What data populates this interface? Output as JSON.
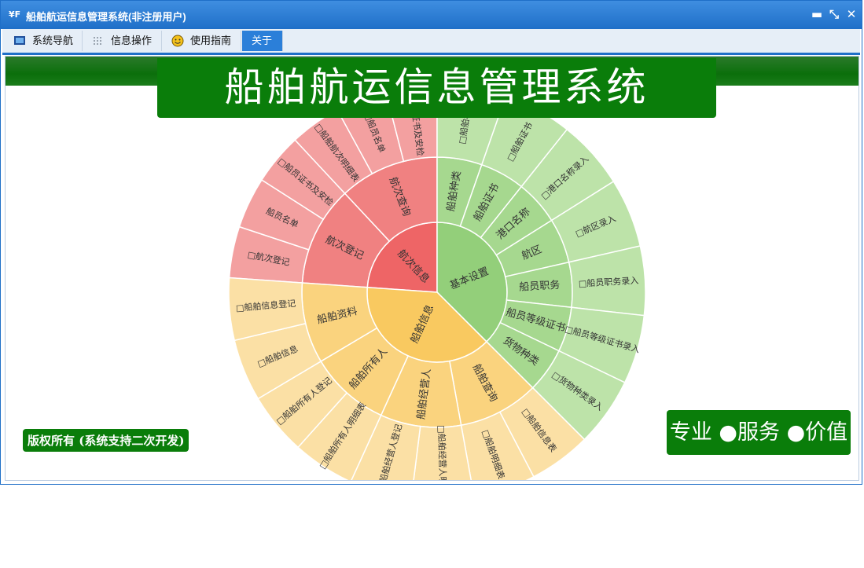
{
  "window": {
    "title": "船舶航运信息管理系统(非注册用户)",
    "icon_text": "¥F",
    "controls": {
      "minimize": "▬",
      "restore": "⤡",
      "close": "✕"
    }
  },
  "menu": {
    "items": [
      {
        "label": "系统导航",
        "icon": "monitor-icon"
      },
      {
        "label": "信息操作",
        "icon": "grid-icon"
      },
      {
        "label": "使用指南",
        "icon": "smile-icon"
      },
      {
        "label": "关于",
        "icon": ""
      }
    ],
    "active_index": 3
  },
  "banner": {
    "title": "船舶航运信息管理系统"
  },
  "footer": {
    "copyright": "版权所有 (系统支持二次开发)",
    "slogan": "专业 ●服务 ●价值"
  },
  "colors": {
    "title_bar": "#1f6fc8",
    "banner_green": "#0a7d0a",
    "red_inner": "#ee6566",
    "red_mid": "#f08181",
    "red_outer": "#f3a0a0",
    "green_inner": "#93cf7a",
    "green_mid": "#a6d88f",
    "green_outer": "#bde3a9",
    "yellow_inner": "#f9c960",
    "yellow_mid": "#fad37e",
    "yellow_outer": "#fbe0a5"
  },
  "chart_data": {
    "type": "sunburst",
    "root": [
      {
        "name": "航次信息",
        "children": [
          {
            "name": "航次登记",
            "children": [
              "□航次登记",
              "船员名单",
              "□船员证书及安检"
            ]
          },
          {
            "name": "航次查询",
            "children": [
              "□船舶航次明细表",
              "□船员名单",
              "□船员证书及安检"
            ]
          }
        ]
      },
      {
        "name": "基本设置",
        "children": [
          {
            "name": "船舶种类",
            "children": [
              "□船舶种类"
            ]
          },
          {
            "name": "船舶证书",
            "children": [
              "□船舶证书"
            ]
          },
          {
            "name": "港口名称",
            "children": [
              "□港口名称录入"
            ]
          },
          {
            "name": "航区",
            "children": [
              "□航区录入"
            ]
          },
          {
            "name": "船员职务",
            "children": [
              "□船员职务录入"
            ]
          },
          {
            "name": "船员等级证书",
            "children": [
              "□船员等级证书录入"
            ]
          },
          {
            "name": "货物种类",
            "children": [
              "□货物种类录入"
            ]
          }
        ]
      },
      {
        "name": "船舶信息",
        "children": [
          {
            "name": "船舶查询",
            "children": [
              "□船舶信息表",
              "□船舶明细表"
            ]
          },
          {
            "name": "船舶经营人",
            "children": [
              "□船舶经营人明细表",
              "□船舶经营人登记"
            ]
          },
          {
            "name": "船舶所有人",
            "children": [
              "□船舶所有人明细表",
              "□船舶所有人登记"
            ]
          },
          {
            "name": "船舶资料",
            "children": [
              "□船舶信息",
              "□船舶信息登记"
            ]
          }
        ]
      }
    ]
  }
}
